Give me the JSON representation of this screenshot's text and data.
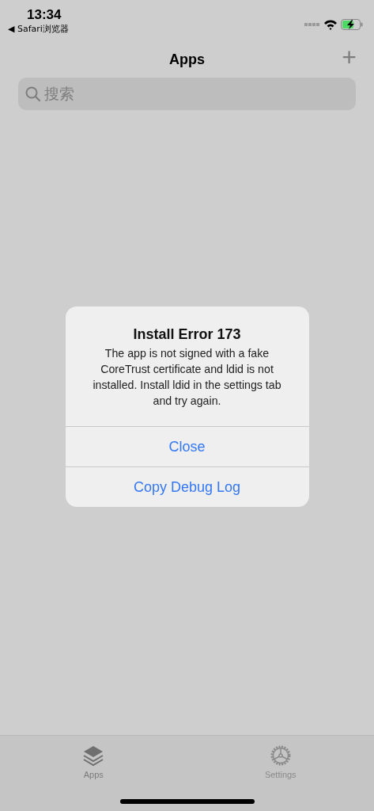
{
  "status_bar": {
    "time": "13:34",
    "back_link": "◀ Safari浏览器",
    "battery_charging": true
  },
  "nav": {
    "title": "Apps",
    "add_symbol": "+"
  },
  "search": {
    "placeholder": "搜索"
  },
  "alert": {
    "title": "Install Error 173",
    "message": "The app is not signed with a fake CoreTrust certificate and ldid is not installed. Install ldid in the settings tab and try again.",
    "buttons": [
      "Close",
      "Copy Debug Log"
    ]
  },
  "tabs": [
    {
      "label": "Apps",
      "kind": "apps",
      "selected": true
    },
    {
      "label": "Settings",
      "kind": "settings",
      "selected": false
    }
  ]
}
